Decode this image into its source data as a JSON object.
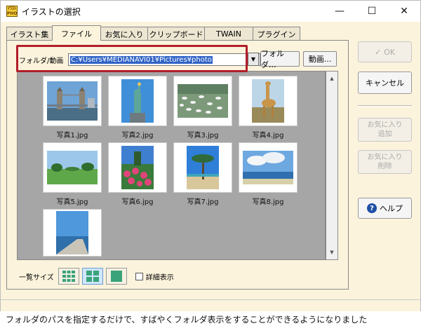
{
  "window": {
    "title": "イラストの選択",
    "icon_text": "ｲﾗｽﾄ PHOTO",
    "controls": {
      "minimize": "—",
      "maximize": "☐",
      "close": "✕"
    }
  },
  "tabs": [
    {
      "label": "イラスト集"
    },
    {
      "label": "ファイル"
    },
    {
      "label": "お気に入り"
    },
    {
      "label": "クリップボード"
    },
    {
      "label": "TWAIN"
    },
    {
      "label": "プラグイン"
    }
  ],
  "path": {
    "label": "フォルダ/動画",
    "value": "C:¥Users¥MEDIANAVI01¥Pictures¥photo",
    "dropdown_icon": "chevron-down-icon",
    "folder_button": "フォルダ...",
    "video_button": "動画..."
  },
  "thumbnails": [
    {
      "label": "写真1.jpg"
    },
    {
      "label": "写真2.jpg"
    },
    {
      "label": "写真3.jpg"
    },
    {
      "label": "写真4.jpg"
    },
    {
      "label": "写真5.jpg"
    },
    {
      "label": "写真6.jpg"
    },
    {
      "label": "写真7.jpg"
    },
    {
      "label": "写真8.jpg"
    },
    {
      "label": ""
    }
  ],
  "size_options": {
    "label": "一覧サイズ",
    "detail_label": "詳細表示"
  },
  "side_buttons": {
    "ok": "OK",
    "cancel": "キャンセル",
    "fav_add": "お気に入り\n追加",
    "fav_del": "お気に入り\n削除",
    "help": "ヘルプ"
  },
  "caption": "フォルダのパスを指定するだけで、すばやくフォルダ表示をすることができるようになりました",
  "colors": {
    "window_bg": "#fbf3dc",
    "highlight": "#b21e2a",
    "selection": "#2f63c6",
    "grid_bg": "#a6a6a6"
  }
}
